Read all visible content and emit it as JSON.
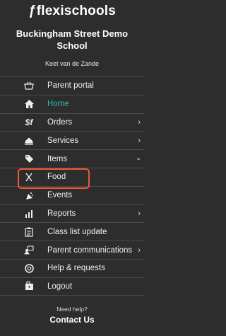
{
  "brand": {
    "logo_text": "flexischools"
  },
  "school_name": "Buckingham Street Demo School",
  "user_name": "Keet van de Zande",
  "menu": [
    {
      "label": "Parent portal",
      "icon": "basket-icon",
      "chevron": ""
    },
    {
      "label": "Home",
      "icon": "home-icon",
      "chevron": "",
      "active": true
    },
    {
      "label": "Orders",
      "icon": "orders-icon",
      "chevron": "›"
    },
    {
      "label": "Services",
      "icon": "services-icon",
      "chevron": "›"
    },
    {
      "label": "Items",
      "icon": "tag-icon",
      "chevron": "›",
      "expanded": true
    },
    {
      "label": "Food",
      "icon": "utensils-icon",
      "chevron": ""
    },
    {
      "label": "Events",
      "icon": "events-icon",
      "chevron": ""
    },
    {
      "label": "Reports",
      "icon": "bar-chart-icon",
      "chevron": "›"
    },
    {
      "label": "Class list update",
      "icon": "clipboard-icon",
      "chevron": ""
    },
    {
      "label": "Parent communications",
      "icon": "communications-icon",
      "chevron": "›"
    },
    {
      "label": "Help & requests",
      "icon": "lifebuoy-icon",
      "chevron": ""
    },
    {
      "label": "Logout",
      "icon": "logout-icon",
      "chevron": ""
    }
  ],
  "footer": {
    "help_text": "Need help?",
    "contact_label": "Contact Us"
  },
  "colors": {
    "background": "#2d2d2d",
    "accent": "#27c1a4",
    "highlight": "#ee5a33"
  }
}
